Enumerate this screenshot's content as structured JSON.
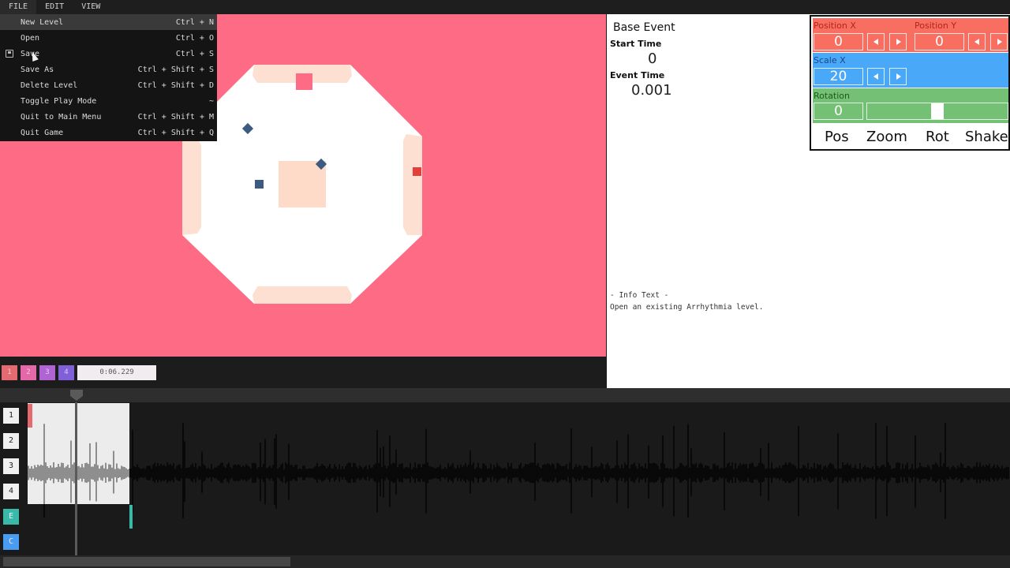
{
  "menubar": {
    "items": [
      {
        "label": "FILE",
        "active": true
      },
      {
        "label": "EDIT",
        "active": false
      },
      {
        "label": "VIEW",
        "active": false
      }
    ]
  },
  "file_menu": {
    "items": [
      {
        "label": "New Level",
        "shortcut": "Ctrl + N",
        "highlight": true,
        "icon": ""
      },
      {
        "label": "Open",
        "shortcut": "Ctrl + O",
        "highlight": false,
        "icon": ""
      },
      {
        "label": "Save",
        "shortcut": "Ctrl + S",
        "highlight": false,
        "icon": "save-icon"
      },
      {
        "label": "Save As",
        "shortcut": "Ctrl + Shift + S",
        "highlight": false,
        "icon": ""
      },
      {
        "label": "Delete Level",
        "shortcut": "Ctrl + Shift + D",
        "highlight": false,
        "icon": ""
      },
      {
        "label": "Toggle Play Mode",
        "shortcut": "~",
        "highlight": false,
        "icon": ""
      },
      {
        "label": "Quit to Main Menu",
        "shortcut": "Ctrl + Shift + M",
        "highlight": false,
        "icon": ""
      },
      {
        "label": "Quit Game",
        "shortcut": "Ctrl + Shift + Q",
        "highlight": false,
        "icon": ""
      }
    ]
  },
  "stage": {
    "background_color": "#fe6b85",
    "arena_color": "#ffffff",
    "pad_color": "#fde0d2",
    "enemy_blue": "#3d5a80",
    "enemy_red": "#e0423a",
    "enemy_pink": "#fe6b85"
  },
  "stage_toolbar": {
    "layers": [
      {
        "label": "1",
        "color": "#e46a70"
      },
      {
        "label": "2",
        "color": "#e468a8"
      },
      {
        "label": "3",
        "color": "#b064d4"
      },
      {
        "label": "4",
        "color": "#8060d8"
      }
    ],
    "time": "0:06.229"
  },
  "event_panel": {
    "title": "Base Event",
    "start_time_label": "Start Time",
    "start_time_value": "0",
    "event_time_label": "Event Time",
    "event_time_value": "0.001",
    "info_heading": "- Info Text -",
    "info_text": "Open an existing Arrhythmia level."
  },
  "camera_panel": {
    "position_x": {
      "label": "Position X",
      "value": "0"
    },
    "position_y": {
      "label": "Position Y",
      "value": "0"
    },
    "scale_x": {
      "label": "Scale X",
      "value": "20"
    },
    "rotation": {
      "label": "Rotation",
      "value": "0",
      "slider": 0.5
    },
    "colors": {
      "position": "#f86e60",
      "scale": "#4aa8f8",
      "rotation": "#74c074"
    },
    "tabs": [
      "Pos",
      "Zoom",
      "Rot",
      "Shake"
    ]
  },
  "timeline": {
    "tracks": [
      {
        "label": "1",
        "color": "#f0f0f0",
        "text_color": "#222"
      },
      {
        "label": "2",
        "color": "#f0f0f0",
        "text_color": "#222"
      },
      {
        "label": "3",
        "color": "#f0f0f0",
        "text_color": "#222"
      },
      {
        "label": "4",
        "color": "#f0f0f0",
        "text_color": "#222"
      },
      {
        "label": "E",
        "color": "#3ab8a8",
        "text_color": "#dff"
      },
      {
        "label": "C",
        "color": "#4a9cf0",
        "text_color": "#def"
      }
    ]
  }
}
